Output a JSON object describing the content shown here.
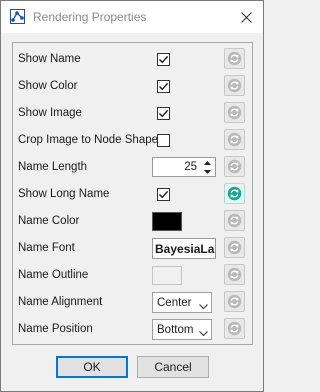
{
  "window": {
    "title": "Rendering Properties",
    "app_icon": "graph-node-icon",
    "close_icon": "close-icon"
  },
  "colors": {
    "reset_inactive": "#b9b9b9",
    "reset_active": "#16a597",
    "name_color_swatch": "#000000",
    "name_outline_swatch": "#f0f0f0",
    "ok_border": "#0078d7"
  },
  "properties": [
    {
      "label": "Show Name",
      "control": "checkbox",
      "checked": true,
      "reset_active": false
    },
    {
      "label": "Show Color",
      "control": "checkbox",
      "checked": true,
      "reset_active": false
    },
    {
      "label": "Show Image",
      "control": "checkbox",
      "checked": true,
      "reset_active": false
    },
    {
      "label": "Crop Image to Node Shape",
      "control": "checkbox",
      "checked": false,
      "reset_active": false
    },
    {
      "label": "Name Length",
      "control": "spinner",
      "value": "25",
      "reset_active": false
    },
    {
      "label": "Show Long Name",
      "control": "checkbox",
      "checked": true,
      "reset_active": true
    },
    {
      "label": "Name Color",
      "control": "color",
      "value": "#000000",
      "reset_active": false
    },
    {
      "label": "Name Font",
      "control": "font",
      "value": "BayesiaLab",
      "reset_active": false
    },
    {
      "label": "Name Outline",
      "control": "color",
      "value": "#f0f0f0",
      "reset_active": false
    },
    {
      "label": "Name Alignment",
      "control": "select",
      "value": "Center",
      "reset_active": false
    },
    {
      "label": "Name Position",
      "control": "select",
      "value": "Bottom",
      "reset_active": false
    }
  ],
  "buttons": {
    "ok": "OK",
    "cancel": "Cancel"
  }
}
